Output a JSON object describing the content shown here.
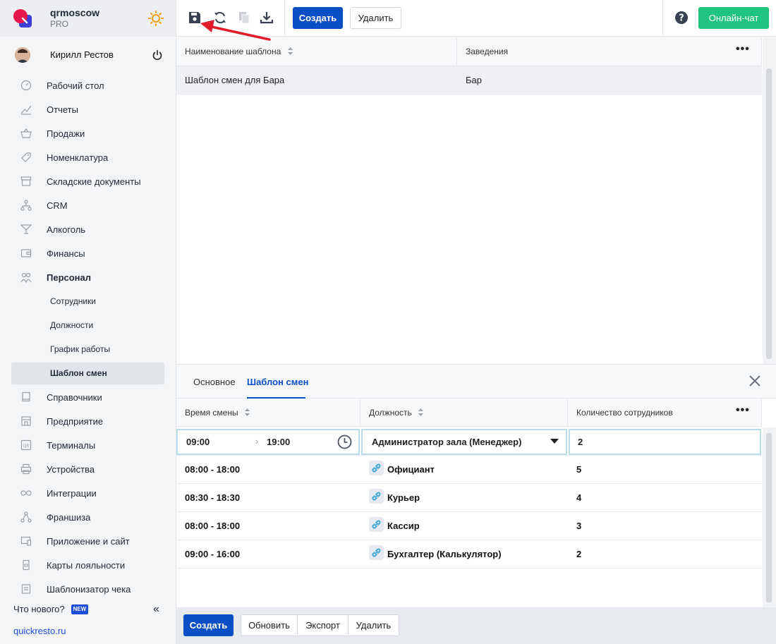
{
  "brand": {
    "name": "qrmoscow",
    "plan": "PRO"
  },
  "user": {
    "name": "Кирилл Рестов"
  },
  "nav": {
    "items": [
      {
        "label": "Рабочий стол"
      },
      {
        "label": "Отчеты"
      },
      {
        "label": "Продажи"
      },
      {
        "label": "Номенклатура"
      },
      {
        "label": "Складские документы"
      },
      {
        "label": "CRM"
      },
      {
        "label": "Алкоголь"
      },
      {
        "label": "Финансы"
      },
      {
        "label": "Персонал"
      }
    ],
    "sub_items": [
      {
        "label": "Сотрудники"
      },
      {
        "label": "Должности"
      },
      {
        "label": "График работы"
      },
      {
        "label": "Шаблон смен"
      }
    ],
    "items_after": [
      {
        "label": "Справочники"
      },
      {
        "label": "Предприятие"
      },
      {
        "label": "Терминалы"
      },
      {
        "label": "Устройства"
      },
      {
        "label": "Интеграции"
      },
      {
        "label": "Франшиза"
      },
      {
        "label": "Приложение и сайт"
      },
      {
        "label": "Карты лояльности"
      },
      {
        "label": "Шаблонизатор чека"
      }
    ]
  },
  "whats_new": {
    "label": "Что нового?",
    "badge": "NEW"
  },
  "site_link": "quickresto.ru",
  "toolbar": {
    "create_label": "Создать",
    "delete_label": "Удалить",
    "chat_label": "Онлайн-чат"
  },
  "templates_table": {
    "columns": [
      "Наименование шаблона",
      "Заведения"
    ],
    "rows": [
      [
        "Шаблон смен для Бара",
        "Бар"
      ]
    ]
  },
  "panel": {
    "tabs": [
      "Основное",
      "Шаблон смен"
    ],
    "columns": [
      "Время смены",
      "Должность",
      "Количество сотрудников"
    ],
    "edit_row": {
      "start": "09:00",
      "end": "19:00",
      "position": "Администратор зала (Менеджер)",
      "count": "2"
    },
    "rows": [
      {
        "time": "08:00 - 18:00",
        "position": "Официант",
        "count": "5"
      },
      {
        "time": "08:30 - 18:30",
        "position": "Курьер",
        "count": "4"
      },
      {
        "time": "08:00 - 18:00",
        "position": "Кассир",
        "count": "3"
      },
      {
        "time": "09:00 - 16:00",
        "position": "Бухгалтер (Калькулятор)",
        "count": "2"
      }
    ]
  },
  "footer": {
    "create_label": "Создать",
    "refresh_label": "Обновить",
    "export_label": "Экспорт",
    "delete_label": "Удалить"
  },
  "colors": {
    "primary": "#0b4fc7",
    "chat": "#21c47e",
    "annotation_arrow": "#e11d2a"
  }
}
